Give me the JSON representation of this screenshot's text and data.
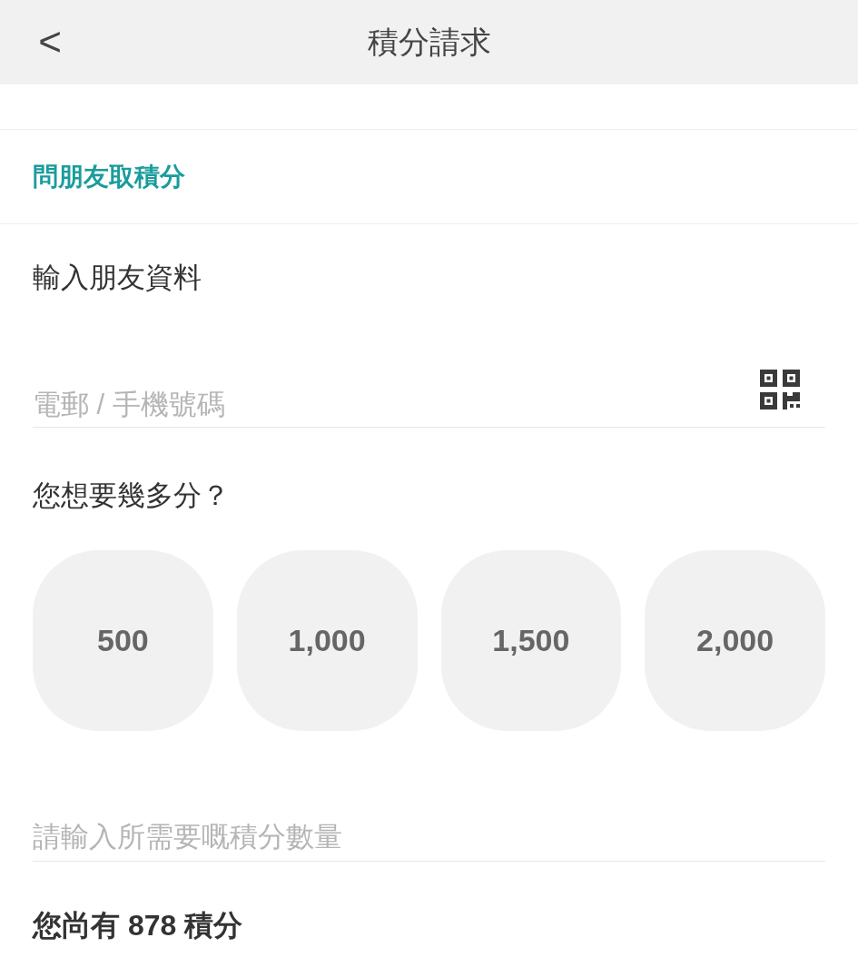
{
  "header": {
    "back": "<",
    "title": "積分請求"
  },
  "section_title": "問朋友取積分",
  "friend_label": "輸入朋友資料",
  "friend_field": {
    "placeholder": "電郵 / 手機號碼"
  },
  "amount_question": "您想要幾多分？",
  "amount_options": [
    "500",
    "1,000",
    "1,500",
    "2,000"
  ],
  "amount_field": {
    "placeholder": "請輸入所需要嘅積分數量"
  },
  "balance": "您尚有 878 積分"
}
